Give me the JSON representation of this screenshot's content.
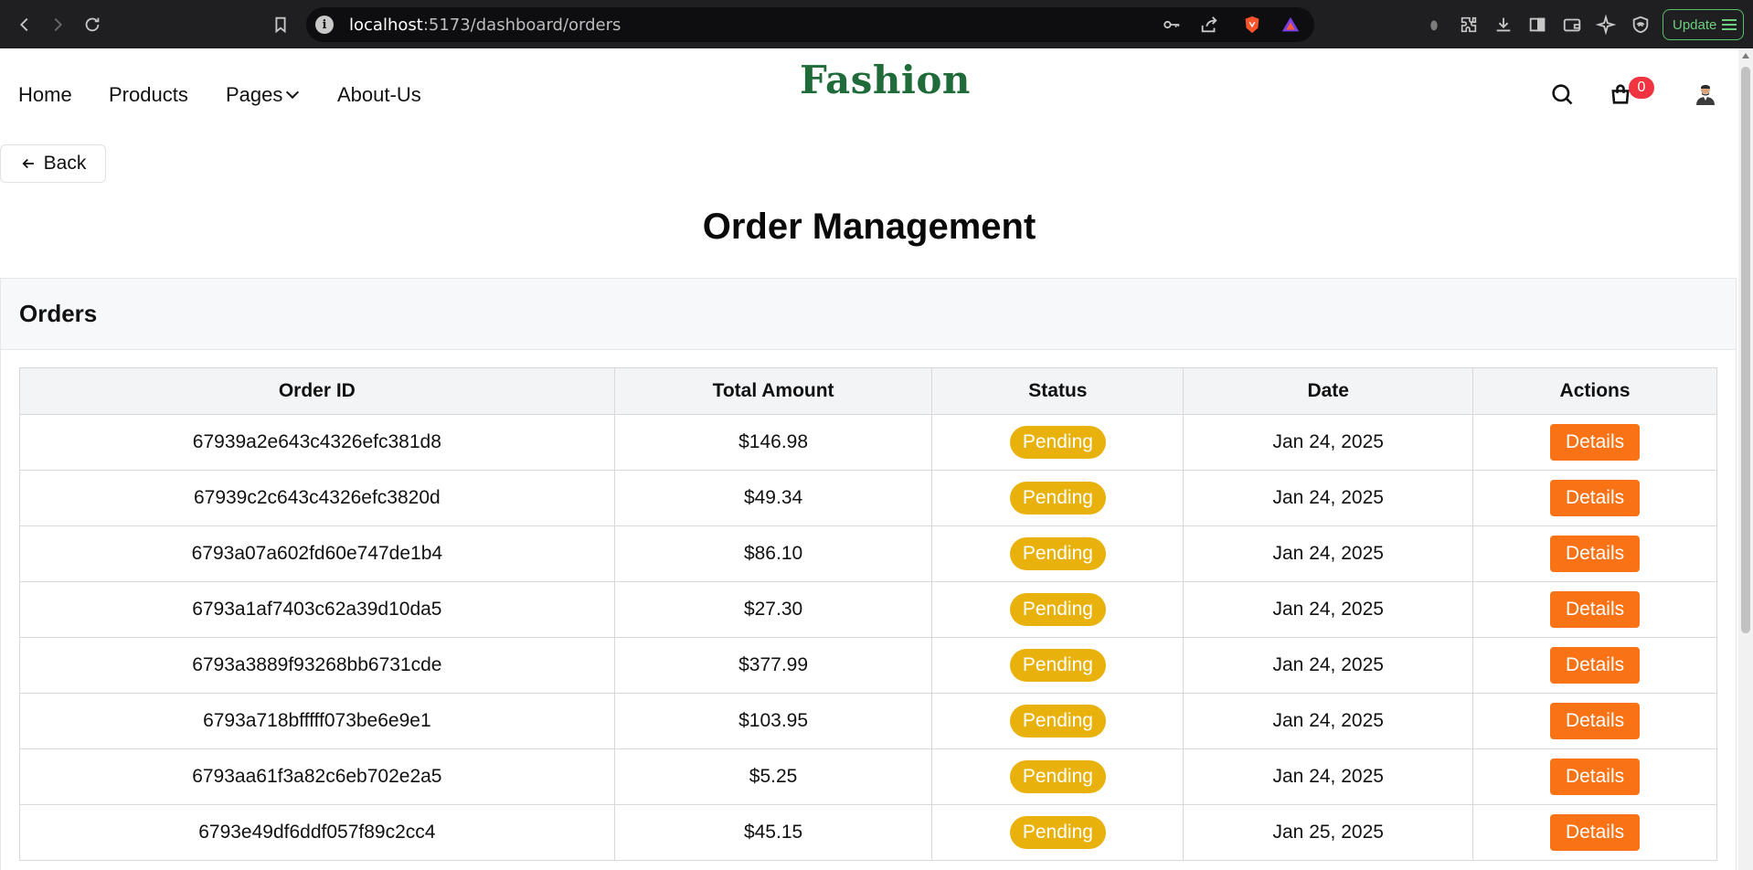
{
  "browser": {
    "url_host": "localhost",
    "url_rest": ":5173/dashboard/orders",
    "update_label": "Update"
  },
  "nav": {
    "links": [
      "Home",
      "Products",
      "Pages",
      "About-Us"
    ],
    "logo": "Fashion",
    "cart_count": "0"
  },
  "back_label": "Back",
  "page_title": "Order Management",
  "orders_card": {
    "title": "Orders",
    "columns": [
      "Order ID",
      "Total Amount",
      "Status",
      "Date",
      "Actions"
    ],
    "rows": [
      {
        "id": "67939a2e643c4326efc381d8",
        "amount": "$146.98",
        "status": "Pending",
        "date": "Jan 24, 2025",
        "action": "Details"
      },
      {
        "id": "67939c2c643c4326efc3820d",
        "amount": "$49.34",
        "status": "Pending",
        "date": "Jan 24, 2025",
        "action": "Details"
      },
      {
        "id": "6793a07a602fd60e747de1b4",
        "amount": "$86.10",
        "status": "Pending",
        "date": "Jan 24, 2025",
        "action": "Details"
      },
      {
        "id": "6793a1af7403c62a39d10da5",
        "amount": "$27.30",
        "status": "Pending",
        "date": "Jan 24, 2025",
        "action": "Details"
      },
      {
        "id": "6793a3889f93268bb6731cde",
        "amount": "$377.99",
        "status": "Pending",
        "date": "Jan 24, 2025",
        "action": "Details"
      },
      {
        "id": "6793a718bfffff073be6e9e1",
        "amount": "$103.95",
        "status": "Pending",
        "date": "Jan 24, 2025",
        "action": "Details"
      },
      {
        "id": "6793aa61f3a82c6eb702e2a5",
        "amount": "$5.25",
        "status": "Pending",
        "date": "Jan 24, 2025",
        "action": "Details"
      },
      {
        "id": "6793e49df6ddf057f89c2cc4",
        "amount": "$45.15",
        "status": "Pending",
        "date": "Jan 25, 2025",
        "action": "Details"
      }
    ]
  },
  "colors": {
    "brand_green": "#1f6b3a",
    "pending": "#e9b10b",
    "details": "#f97316",
    "cart_badge": "#ef3340"
  }
}
